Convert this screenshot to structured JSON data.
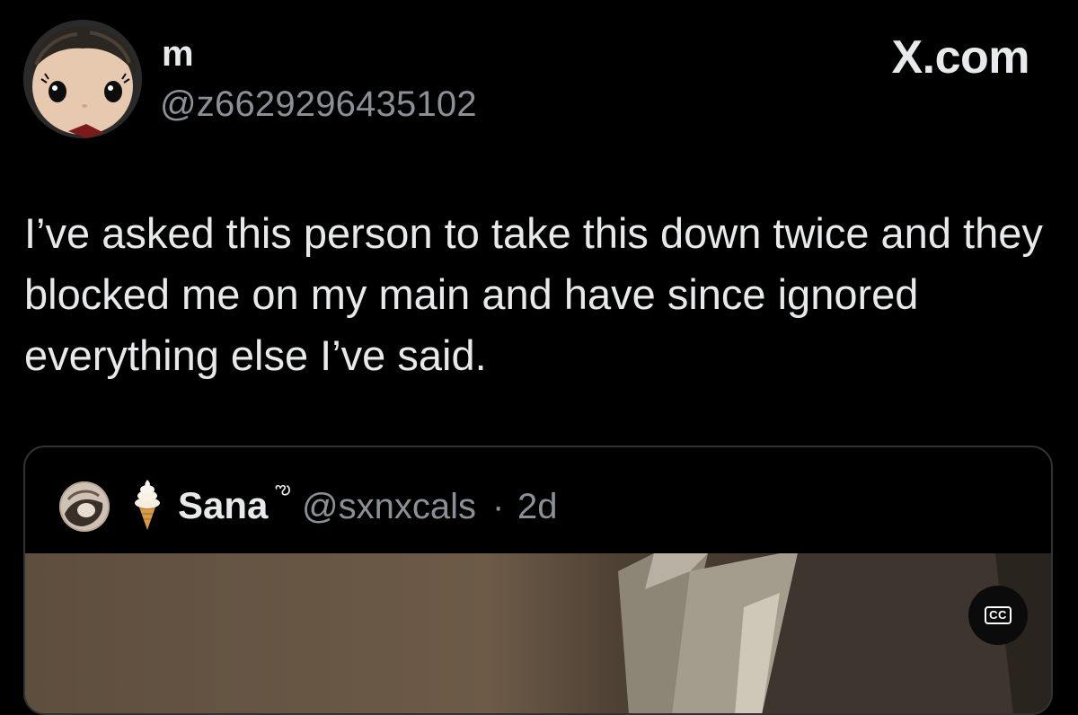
{
  "author": {
    "name": "m",
    "handle": "@z6629296435102",
    "avatar_icon": "funko-pop-avatar"
  },
  "brand": {
    "label": "X.com"
  },
  "tweet": {
    "text": "I’ve asked this person to take this down twice and they blocked me on my main and have since ignored everything else I’ve said."
  },
  "quote": {
    "emoji_icon": "soft-serve-ice-cream-icon",
    "name": "Sana",
    "name_decoration": "ఌ",
    "handle": "@sxnxcals",
    "separator": "·",
    "time": "2d",
    "media": {
      "cc_label": "CC",
      "cc_icon": "closed-captions-icon"
    }
  },
  "colors": {
    "background": "#000000",
    "primary_text": "#e7e9ea",
    "secondary_text": "#8b9096",
    "border": "#2f3336"
  }
}
